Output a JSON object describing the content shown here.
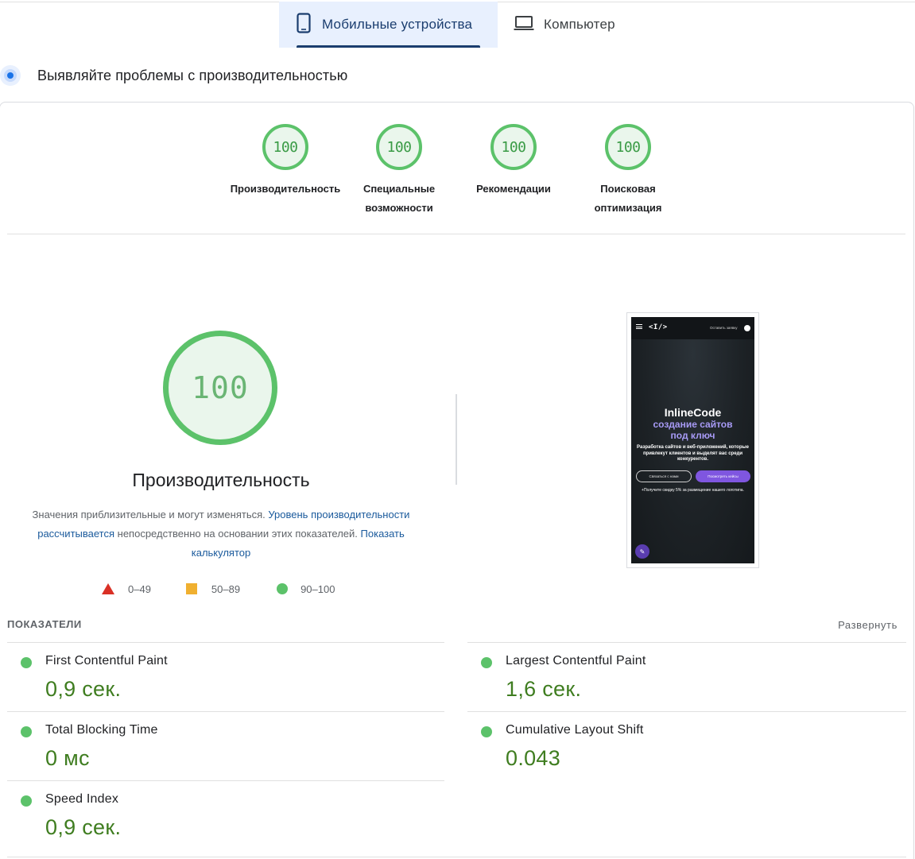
{
  "tabs": {
    "mobile_label": "Мобильные устройства",
    "desktop_label": "Компьютер"
  },
  "header": {
    "title": "Выявляйте проблемы с производительностью"
  },
  "scores": [
    {
      "value": "100",
      "label": "Производительность"
    },
    {
      "value": "100",
      "label": "Специальные возможности"
    },
    {
      "value": "100",
      "label": "Рекомендации"
    },
    {
      "value": "100",
      "label": "Поисковая оптимизация"
    }
  ],
  "performance": {
    "score": "100",
    "title": "Производительность",
    "desc_text1": "Значения приблизительные и могут изменяться.",
    "desc_link1": "Уровень производительности рассчитывается",
    "desc_text2": "непосредственно на основании этих показателей.",
    "desc_link2": "Показать калькулятор"
  },
  "legend": {
    "fail": "0–49",
    "average": "50–89",
    "pass": "90–100"
  },
  "screenshot": {
    "logo": "<I/>",
    "request_label": "Оставить заявку",
    "brand": "InlineCode",
    "subtitle_line1": "создание сайтов",
    "subtitle_line2": "под ключ",
    "description": "Разработка сайтов и веб-приложений, которые привлекут клиентов и выделят вас среди конкурентов.",
    "btn_contact": "Связаться с нами",
    "btn_cases": "Посмотреть кейсы",
    "promo": "+Получите скидку 5% за размещение нашего логотипа."
  },
  "metrics": {
    "title": "ПОКАЗАТЕЛИ",
    "expand_label": "Развернуть",
    "items": [
      {
        "name": "First Contentful Paint",
        "value": "0,9 сек."
      },
      {
        "name": "Largest Contentful Paint",
        "value": "1,6 сек."
      },
      {
        "name": "Total Blocking Time",
        "value": "0 мс"
      },
      {
        "name": "Cumulative Layout Shift",
        "value": "0.043"
      },
      {
        "name": "Speed Index",
        "value": "0,9 сек."
      }
    ]
  },
  "colors": {
    "pass": "#5cc26a",
    "average": "#f0b030",
    "fail": "#d93025",
    "metric_value": "#3f7d20",
    "link": "#1a5a9c",
    "tab_active": "#1a3d6e"
  },
  "icons": {
    "mobile_tab": "smartphone-icon",
    "desktop_tab": "laptop-icon",
    "header": "performance-gauge-icon"
  }
}
